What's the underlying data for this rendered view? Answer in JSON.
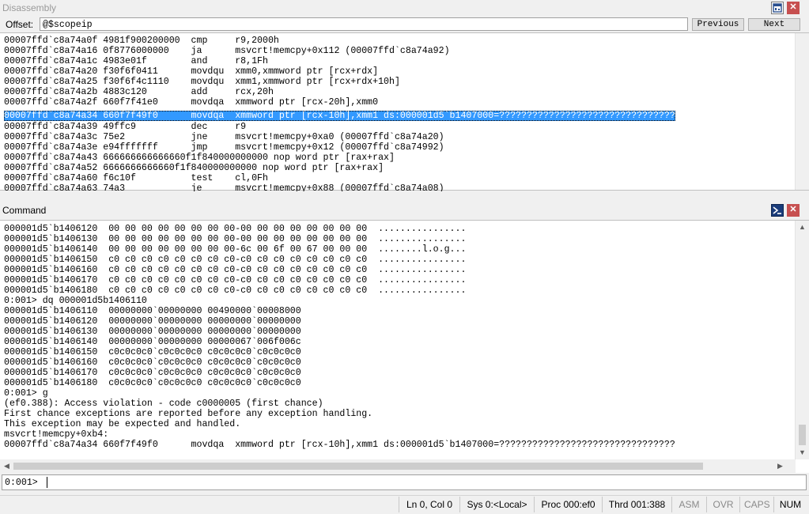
{
  "disasm": {
    "title": "Disassembly",
    "offset_label": "Offset:",
    "offset_value": "@$scopeip",
    "prev_label": "Previous",
    "next_label": "Next",
    "lines": [
      {
        "text": "00007ffd`c8a74a0f 4981f900200000  cmp     r9,2000h",
        "highlight": false
      },
      {
        "text": "00007ffd`c8a74a16 0f8776000000    ja      msvcrt!memcpy+0x112 (00007ffd`c8a74a92)",
        "highlight": false
      },
      {
        "text": "00007ffd`c8a74a1c 4983e01f        and     r8,1Fh",
        "highlight": false
      },
      {
        "text": "00007ffd`c8a74a20 f30f6f0411      movdqu  xmm0,xmmword ptr [rcx+rdx]",
        "highlight": false
      },
      {
        "text": "00007ffd`c8a74a25 f30f6f4c1110    movdqu  xmm1,xmmword ptr [rcx+rdx+10h]",
        "highlight": false
      },
      {
        "text": "00007ffd`c8a74a2b 4883c120        add     rcx,20h",
        "highlight": false
      },
      {
        "text": "00007ffd`c8a74a2f 660f7f41e0      movdqa  xmmword ptr [rcx-20h],xmm0",
        "highlight": false
      },
      {
        "text": "00007ffd`c8a74a34 660f7f49f0      movdqa  xmmword ptr [rcx-10h],xmm1 ds:000001d5`b1407000=????????????????????????????????",
        "highlight": true
      },
      {
        "text": "00007ffd`c8a74a39 49ffc9          dec     r9",
        "highlight": false
      },
      {
        "text": "00007ffd`c8a74a3c 75e2            jne     msvcrt!memcpy+0xa0 (00007ffd`c8a74a20)",
        "highlight": false
      },
      {
        "text": "00007ffd`c8a74a3e e94fffffff      jmp     msvcrt!memcpy+0x12 (00007ffd`c8a74992)",
        "highlight": false
      },
      {
        "text": "00007ffd`c8a74a43 666666666666660f1f840000000000 nop word ptr [rax+rax]",
        "highlight": false
      },
      {
        "text": "00007ffd`c8a74a52 6666666666660f1f840000000000 nop word ptr [rax+rax]",
        "highlight": false
      },
      {
        "text": "00007ffd`c8a74a60 f6c10f          test    cl,0Fh",
        "highlight": false
      },
      {
        "text": "00007ffd`c8a74a63 74a3            je      msvcrt!memcpy+0x88 (00007ffd`c8a74a08)",
        "highlight": false
      }
    ]
  },
  "command": {
    "title": "Command",
    "lines": [
      "000001d5`b1406120  00 00 00 00 00 00 00 00-00 00 00 00 00 00 00 00  ................",
      "000001d5`b1406130  00 00 00 00 00 00 00 00-00 00 00 00 00 00 00 00  ................",
      "000001d5`b1406140  00 00 00 00 00 00 00 00-6c 00 6f 00 67 00 00 00  ........l.o.g...",
      "000001d5`b1406150  c0 c0 c0 c0 c0 c0 c0 c0-c0 c0 c0 c0 c0 c0 c0 c0  ................",
      "000001d5`b1406160  c0 c0 c0 c0 c0 c0 c0 c0-c0 c0 c0 c0 c0 c0 c0 c0  ................",
      "000001d5`b1406170  c0 c0 c0 c0 c0 c0 c0 c0-c0 c0 c0 c0 c0 c0 c0 c0  ................",
      "000001d5`b1406180  c0 c0 c0 c0 c0 c0 c0 c0-c0 c0 c0 c0 c0 c0 c0 c0  ................",
      "0:001> dq 000001d5b1406110",
      "000001d5`b1406110  00000000`00000000 00490000`00008000",
      "000001d5`b1406120  00000000`00000000 00000000`00000000",
      "000001d5`b1406130  00000000`00000000 00000000`00000000",
      "000001d5`b1406140  00000000`00000000 00000067`006f006c",
      "000001d5`b1406150  c0c0c0c0`c0c0c0c0 c0c0c0c0`c0c0c0c0",
      "000001d5`b1406160  c0c0c0c0`c0c0c0c0 c0c0c0c0`c0c0c0c0",
      "000001d5`b1406170  c0c0c0c0`c0c0c0c0 c0c0c0c0`c0c0c0c0",
      "000001d5`b1406180  c0c0c0c0`c0c0c0c0 c0c0c0c0`c0c0c0c0",
      "0:001> g",
      "(ef0.388): Access violation - code c0000005 (first chance)",
      "First chance exceptions are reported before any exception handling.",
      "This exception may be expected and handled.",
      "msvcrt!memcpy+0xb4:",
      "00007ffd`c8a74a34 660f7f49f0      movdqa  xmmword ptr [rcx-10h],xmm1 ds:000001d5`b1407000=????????????????????????????????"
    ],
    "prompt": "0:001>",
    "input_value": ""
  },
  "status": {
    "position": "Ln 0, Col 0",
    "sys": "Sys 0:<Local>",
    "proc": "Proc 000:ef0",
    "thrd": "Thrd 001:388",
    "asm": "ASM",
    "ovr": "OVR",
    "caps": "CAPS",
    "num": "NUM"
  },
  "icons": {
    "disasm_restore": "window-restore-icon",
    "close": "close-icon",
    "command_prompt": "command-prompt-icon"
  },
  "colors": {
    "highlight": "#3399ff",
    "close_button": "#c75050",
    "title_text_disabled": "#9a9a9a"
  }
}
